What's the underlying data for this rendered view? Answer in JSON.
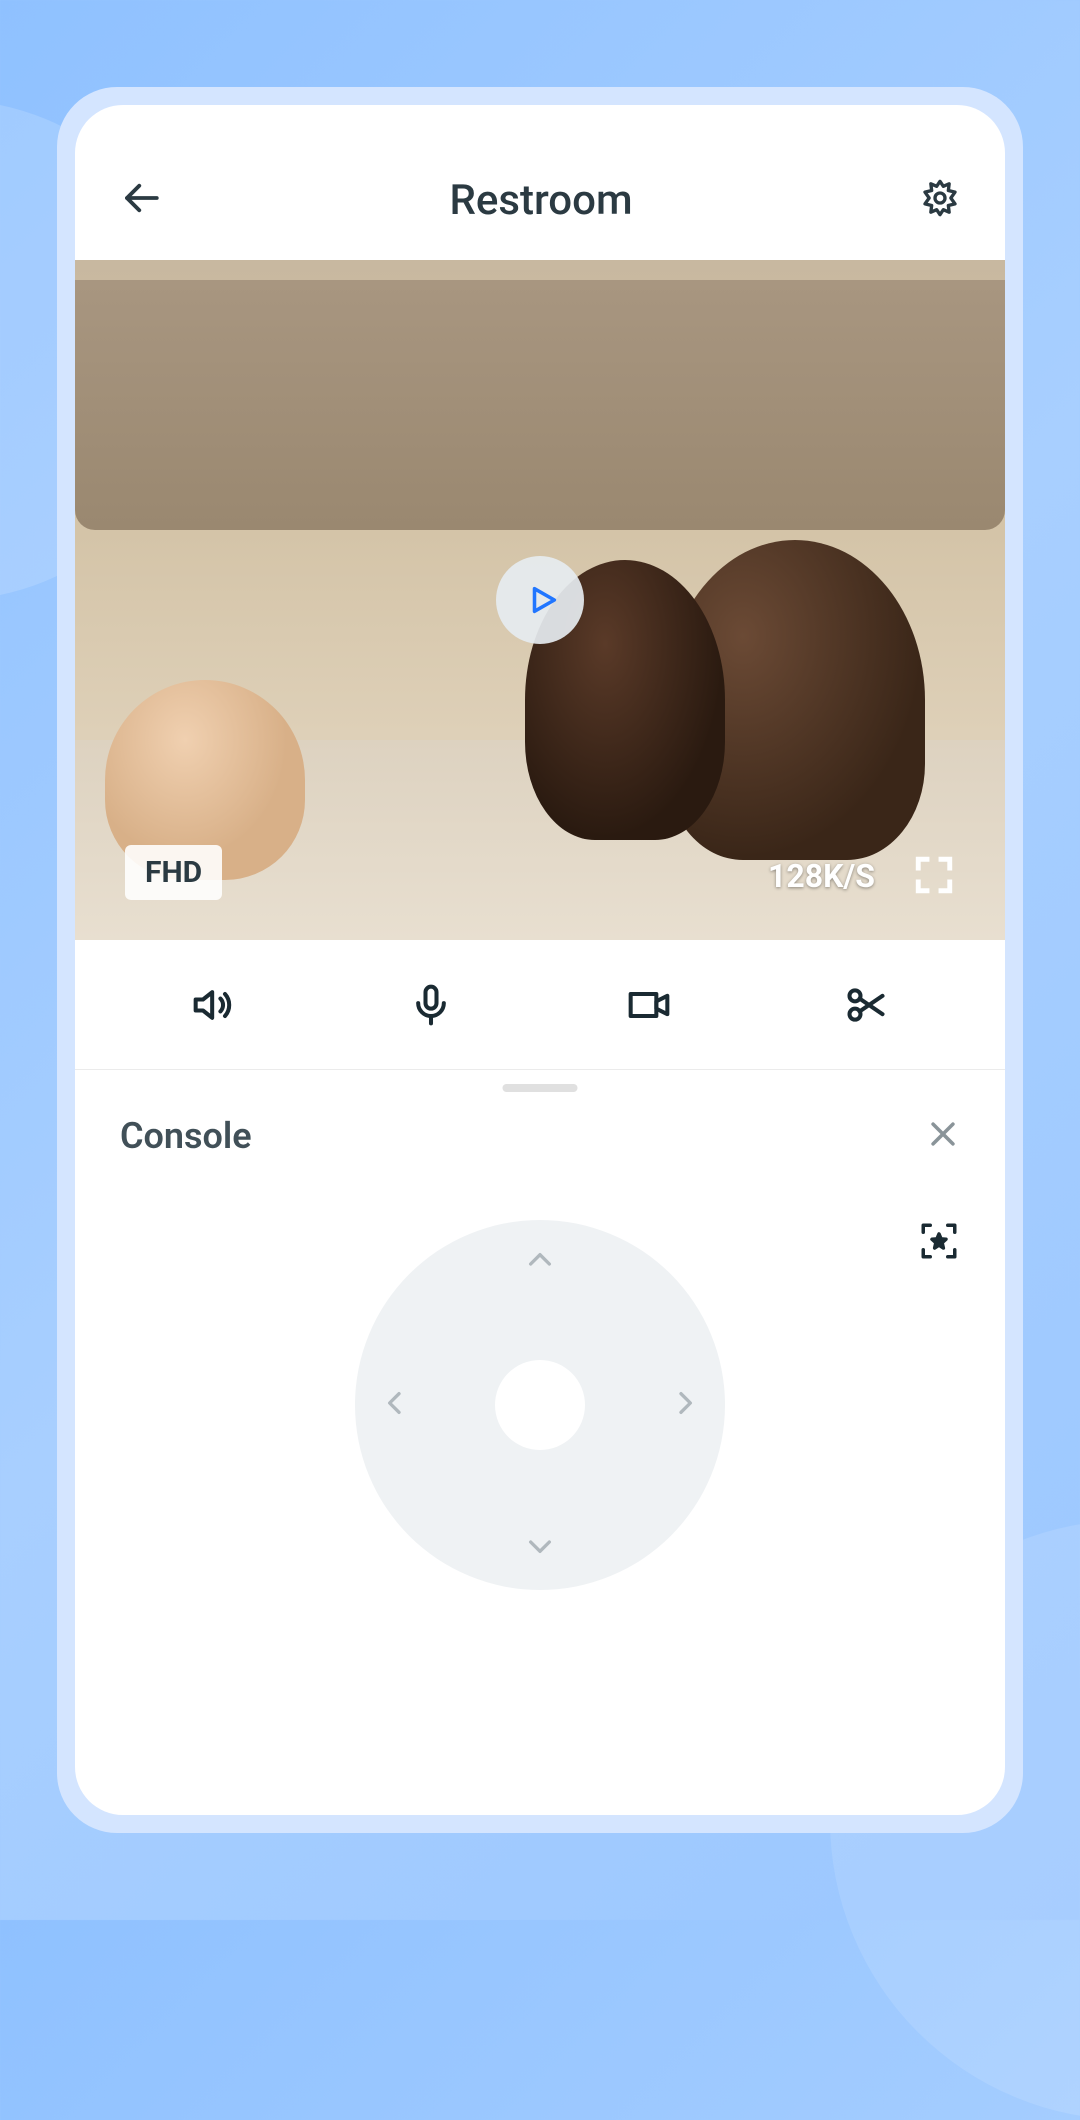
{
  "header": {
    "title": "Restroom"
  },
  "video": {
    "quality_badge": "FHD",
    "bitrate": "128K/S"
  },
  "console": {
    "title": "Console"
  },
  "icons": {
    "back": "arrow-left",
    "settings": "gear",
    "play": "play",
    "fullscreen": "fullscreen",
    "speaker": "speaker",
    "mic": "microphone",
    "record": "video-camera",
    "snip": "scissors",
    "close": "close",
    "calibrate": "focus-star"
  },
  "colors": {
    "accent": "#2176ff",
    "text_primary": "#2b3a42",
    "background": "#8fc1ff"
  }
}
